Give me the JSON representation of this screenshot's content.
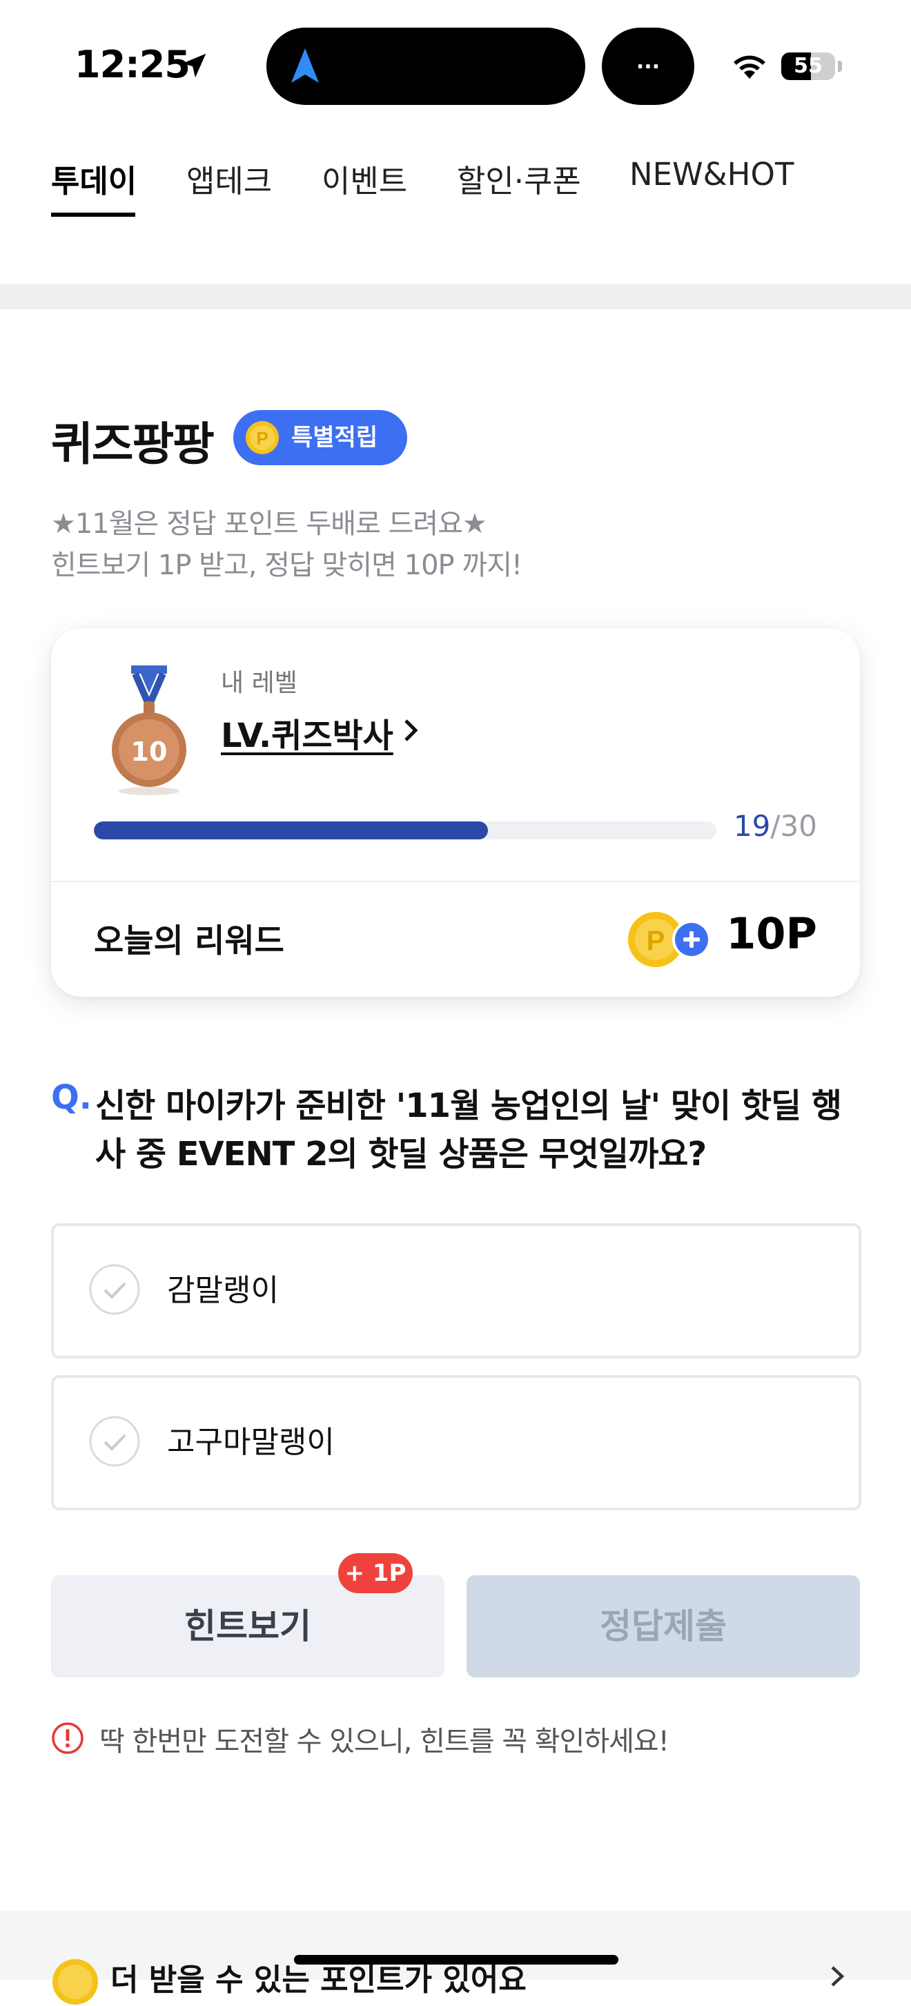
{
  "status_bar": {
    "time": "12:25",
    "island_more": "...",
    "battery": "55",
    "battery_level": 0.55,
    "icons": [
      "location-arrow-icon",
      "nav-arrow-icon",
      "wifi-icon",
      "battery-icon"
    ]
  },
  "tabs": [
    {
      "label": "투데이",
      "active": true
    },
    {
      "label": "앱테크",
      "active": false
    },
    {
      "label": "이벤트",
      "active": false
    },
    {
      "label": "할인·쿠폰",
      "active": false
    },
    {
      "label": "NEW&HOT",
      "active": false
    }
  ],
  "quiz": {
    "title": "퀴즈팡팡",
    "badge": "특별적립",
    "desc_lines": [
      "★11월은 정답 포인트 두배로 드려요★",
      "힌트보기 1P 받고, 정답 맞히면 10P 까지!"
    ]
  },
  "level_card": {
    "caption": "내 레벨",
    "medal_number": "10",
    "level_name": "LV.퀴즈박사",
    "progress_current": "19",
    "progress_total": "/30",
    "progress_ratio": 0.633,
    "reward_label": "오늘의 리워드",
    "reward_value": "10P"
  },
  "question": {
    "marker": "Q.",
    "lines": [
      "신한 마이카가 준비한 '11월 농업인의 날' 맞이 핫딜 행",
      "사 중 EVENT 2의 핫딜 상품은 무엇일까요?"
    ],
    "options": [
      "감말랭이",
      "고구마말랭이"
    ]
  },
  "buttons": {
    "hint": "힌트보기",
    "hint_badge": "+ 1P",
    "submit": "정답제출"
  },
  "warning": "딱 한번만 도전할 수 있으니, 힌트를 꼭 확인하세요!",
  "bottom_banner": {
    "text": "더 받을 수 있는 포인트가 있어요"
  },
  "colors": {
    "accent": "#3d6ff2",
    "progress": "#2a49a8",
    "badge_red": "#f0423c",
    "coin": "#f5c21a",
    "submit_disabled": "#cfdae6"
  }
}
